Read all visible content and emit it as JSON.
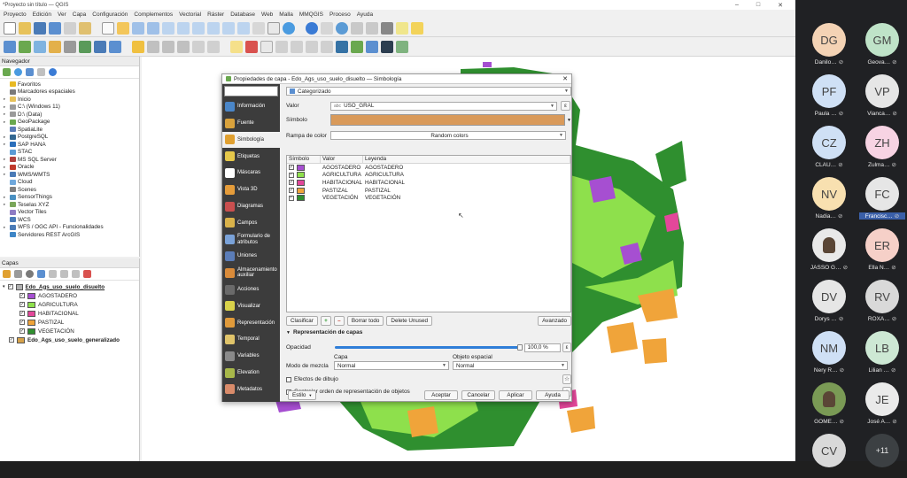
{
  "window": {
    "title": "*Proyecto sin título — QGIS",
    "controls": [
      "–",
      "□",
      "✕"
    ]
  },
  "menu": [
    "Proyecto",
    "Edición",
    "Ver",
    "Capa",
    "Configuración",
    "Complementos",
    "Vectorial",
    "Ráster",
    "Database",
    "Web",
    "Malla",
    "MMQGIS",
    "Proceso",
    "Ayuda"
  ],
  "browser": {
    "title": "Navegador",
    "items": [
      {
        "label": "Favoritos",
        "icon": "star-icon",
        "color": "#e8b923"
      },
      {
        "label": "Marcadores espaciales",
        "icon": "bookmark-icon",
        "color": "#7a7a7a"
      },
      {
        "label": "Inicio",
        "icon": "folder-icon",
        "color": "#e7c25a"
      },
      {
        "label": "C:\\ (Windows 11)",
        "icon": "drive-icon",
        "color": "#9a9a9a"
      },
      {
        "label": "D:\\ (Data)",
        "icon": "drive-icon",
        "color": "#9a9a9a"
      },
      {
        "label": "GeoPackage",
        "icon": "geopackage-icon",
        "color": "#6aa84f"
      },
      {
        "label": "SpatiaLite",
        "icon": "spatialite-icon",
        "color": "#5b7db8"
      },
      {
        "label": "PostgreSQL",
        "icon": "postgresql-icon",
        "color": "#336791"
      },
      {
        "label": "SAP HANA",
        "icon": "sap-icon",
        "color": "#2a6ebb"
      },
      {
        "label": "STAC",
        "icon": "stac-icon",
        "color": "#5b9bd5"
      },
      {
        "label": "MS SQL Server",
        "icon": "mssql-icon",
        "color": "#b0413e"
      },
      {
        "label": "Oracle",
        "icon": "oracle-icon",
        "color": "#c0392b"
      },
      {
        "label": "WMS/WMTS",
        "icon": "wms-icon",
        "color": "#4a7bb7"
      },
      {
        "label": "Cloud",
        "icon": "cloud-icon",
        "color": "#6fa8dc"
      },
      {
        "label": "Scenes",
        "icon": "scenes-icon",
        "color": "#7f7f7f"
      },
      {
        "label": "SensorThings",
        "icon": "sensor-icon",
        "color": "#4a90c2"
      },
      {
        "label": "Teselas XYZ",
        "icon": "xyz-icon",
        "color": "#7aa65a"
      },
      {
        "label": "Vector Tiles",
        "icon": "vector-tiles-icon",
        "color": "#8e7cc3"
      },
      {
        "label": "WCS",
        "icon": "wcs-icon",
        "color": "#4a7bb7"
      },
      {
        "label": "WFS / OGC API - Funcionalidades",
        "icon": "wfs-icon",
        "color": "#4a7bb7"
      },
      {
        "label": "Servidores REST ArcGIS",
        "icon": "arcgis-icon",
        "color": "#3d85c6"
      }
    ]
  },
  "layers": {
    "title": "Capas",
    "layer1": "Edo_Ags_uso_suelo_disuelto",
    "classes": [
      {
        "label": "AGOSTADERO",
        "color": "#a64fd1"
      },
      {
        "label": "AGRICULTURA",
        "color": "#8ee04c"
      },
      {
        "label": "HABITACIONAL",
        "color": "#e3479a"
      },
      {
        "label": "PASTIZAL",
        "color": "#f0a43a"
      },
      {
        "label": "VEGETACIÓN",
        "color": "#2f8f2f"
      }
    ],
    "layer2": "Edo_Ags_uso_suelo_generalizado",
    "layer2_color": "#d6a24a"
  },
  "dialog": {
    "title": "Propiedades de capa - Edo_Ags_uso_suelo_disuelto — Simbología",
    "close": "✕",
    "sidebar": [
      {
        "label": "Información",
        "icon": "info-icon",
        "color": "#4a86c8"
      },
      {
        "label": "Fuente",
        "icon": "source-icon",
        "color": "#d9a23c"
      },
      {
        "label": "Simbología",
        "icon": "symbology-icon",
        "color": "#e0a030"
      },
      {
        "label": "Etiquetas",
        "icon": "labels-icon",
        "color": "#e6c84a"
      },
      {
        "label": "Máscaras",
        "icon": "masks-icon",
        "color": "#ffffff"
      },
      {
        "label": "Vista 3D",
        "icon": "3d-view-icon",
        "color": "#e59c3a"
      },
      {
        "label": "Diagramas",
        "icon": "diagrams-icon",
        "color": "#c94f4f"
      },
      {
        "label": "Campos",
        "icon": "fields-icon",
        "color": "#d9b24a"
      },
      {
        "label": "Formulario de atributos",
        "icon": "attribute-form-icon",
        "color": "#7aa2d8"
      },
      {
        "label": "Uniones",
        "icon": "joins-icon",
        "color": "#5b7db8"
      },
      {
        "label": "Almacenamiento auxiliar",
        "icon": "aux-storage-icon",
        "color": "#d98b3a"
      },
      {
        "label": "Acciones",
        "icon": "actions-icon",
        "color": "#6a6a6a"
      },
      {
        "label": "Visualizar",
        "icon": "display-icon",
        "color": "#d9d24a"
      },
      {
        "label": "Representación",
        "icon": "rendering-icon",
        "color": "#e09a3a"
      },
      {
        "label": "Temporal",
        "icon": "temporal-icon",
        "color": "#e0c46a"
      },
      {
        "label": "Variables",
        "icon": "variables-icon",
        "color": "#8a8a8a"
      },
      {
        "label": "Elevation",
        "icon": "elevation-icon",
        "color": "#a8b84a"
      },
      {
        "label": "Metadatos",
        "icon": "metadata-icon",
        "color": "#d98b6a"
      }
    ],
    "renderer": "Categorizado",
    "value_label": "Valor",
    "value_field": "USO_GRAL",
    "symbol_label": "Símbolo",
    "symbol_color": "#d99a5a",
    "ramp_label": "Rampa de color",
    "ramp_value": "Random colors",
    "columns": [
      "Símbolo",
      "Valor",
      "Leyenda"
    ],
    "rows": [
      {
        "value": "AGOSTADERO",
        "legend": "AGOSTADERO",
        "color": "#a64fd1"
      },
      {
        "value": "AGRICULTURA",
        "legend": "AGRICULTURA",
        "color": "#8ee04c"
      },
      {
        "value": "HABITACIONAL",
        "legend": "HABITACIONAL",
        "color": "#e3479a"
      },
      {
        "value": "PASTIZAL",
        "legend": "PASTIZAL",
        "color": "#f0a43a"
      },
      {
        "value": "VEGETACIÓN",
        "legend": "VEGETACIÓN",
        "color": "#2f8f2f"
      }
    ],
    "classify": "Clasificar",
    "add": "+",
    "remove": "–",
    "delete_all": "Borrar todo",
    "delete_unused": "Delete Unused",
    "advanced": "Avanzado",
    "layer_rendering": "Representación de capas",
    "opacity_label": "Opacidad",
    "opacity_value": "100,0 %",
    "blend_label": "Modo de mezcla",
    "capa_label": "Capa",
    "capa_value": "Normal",
    "objeto_label": "Objeto espacial",
    "objeto_value": "Normal",
    "draw_effects": "Efectos de dibujo",
    "feature_order": "Controlar orden de representación de objetos",
    "style": "Estilo",
    "accept": "Aceptar",
    "cancel": "Cancelar",
    "apply": "Aplicar",
    "help": "Ayuda"
  },
  "participants": [
    {
      "initials": "DG",
      "name": "Danilo…",
      "color": "#f4d3b5"
    },
    {
      "initials": "GM",
      "name": "Geova…",
      "color": "#bfe3c8"
    },
    {
      "initials": "PF",
      "name": "Paula …",
      "color": "#cfe0f5"
    },
    {
      "initials": "VP",
      "name": "Vianca…",
      "color": "#e6e6e6"
    },
    {
      "initials": "CZ",
      "name": "CLAU…",
      "color": "#cfe0f5"
    },
    {
      "initials": "ZH",
      "name": "Zulma…",
      "color": "#f7d3e3"
    },
    {
      "initials": "NV",
      "name": "Nadia…",
      "color": "#f8e0b0"
    },
    {
      "initials": "FC",
      "name": "Francisc…",
      "color": "#e6e6e6",
      "highlight": true
    },
    {
      "initials": "",
      "name": "JASSO G…",
      "color": "#e9e9e9",
      "photo": true
    },
    {
      "initials": "ER",
      "name": "Ella N…",
      "color": "#f6d0c8"
    },
    {
      "initials": "DV",
      "name": "Dorys …",
      "color": "#e6e6e6"
    },
    {
      "initials": "RV",
      "name": "ROXA…",
      "color": "#d9d9d9"
    },
    {
      "initials": "NM",
      "name": "Nery R…",
      "color": "#cfe0f5"
    },
    {
      "initials": "LB",
      "name": "Lilian …",
      "color": "#cde8d4"
    },
    {
      "initials": "",
      "name": "GOME…",
      "color": "#7a9a55",
      "photo": true
    },
    {
      "initials": "JE",
      "name": "José A…",
      "color": "#eaeaea"
    },
    {
      "initials": "CV",
      "name": "",
      "color": "#d9d9d9"
    },
    {
      "initials": "+11",
      "name": "",
      "color": "#3c4043"
    }
  ],
  "colors": {
    "agostadero": "#a64fd1",
    "agricultura": "#8ee04c",
    "habitacional": "#e3479a",
    "pastizal": "#f0a43a",
    "vegetacion": "#2f8f2f"
  }
}
